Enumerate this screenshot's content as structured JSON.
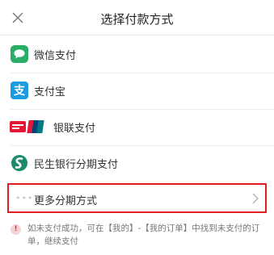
{
  "header": {
    "title": "选择付款方式",
    "close_icon": "close-icon"
  },
  "payment_methods": [
    {
      "label": "微信支付",
      "icon": "wechat-pay-icon",
      "color": "#2aae67"
    },
    {
      "label": "支付宝",
      "icon": "alipay-icon",
      "color": "#1a9ae0",
      "glyph": "支"
    },
    {
      "label": "银联支付",
      "icon": "unionpay-icon",
      "color": "#e21836"
    },
    {
      "label": "民生银行分期支付",
      "icon": "minsheng-bank-icon",
      "color": "#1b8a6a"
    }
  ],
  "more_option": {
    "label": "更多分期方式",
    "dots_icon": "more-dots-icon",
    "chevron_icon": "chevron-right-icon",
    "highlight_color": "#e02020"
  },
  "notice": {
    "icon_glyph": "!",
    "text": "如未支付成功，可在【我的】-【我的订单】中找到未支付的订单，继续支付"
  }
}
